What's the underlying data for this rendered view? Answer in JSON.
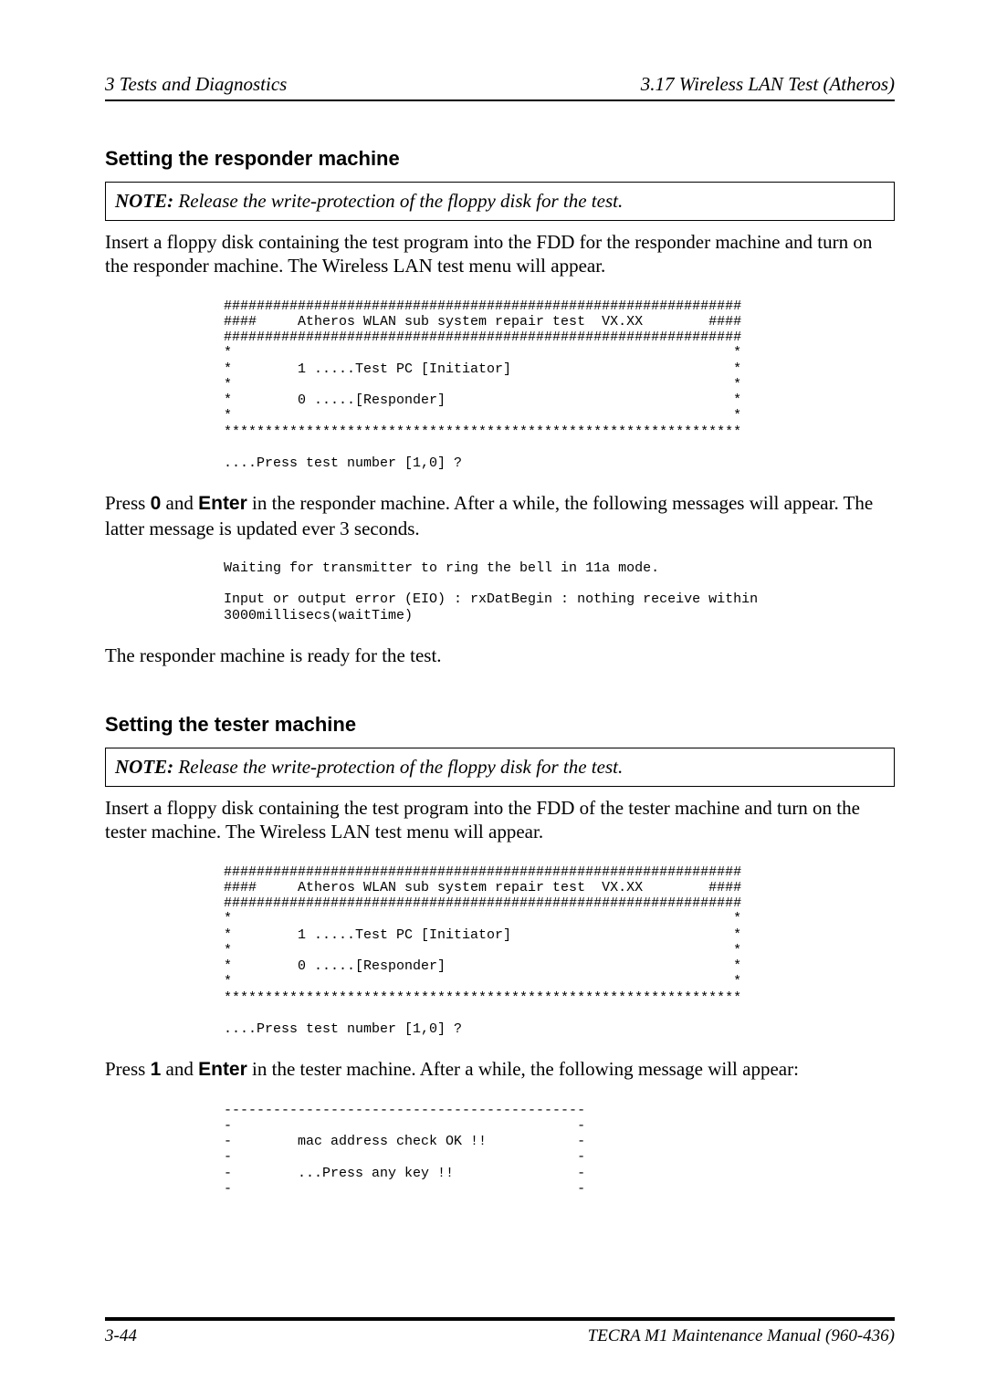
{
  "header": {
    "left": "3   Tests and Diagnostics",
    "right": "3.17  Wireless LAN Test  (Atheros)"
  },
  "section1": {
    "heading": "Setting the responder machine",
    "note_label": "NOTE:",
    "note_text": "  Release the write-protection of the floppy disk for the test.",
    "intro": "Insert a floppy disk containing the test program into the FDD for the responder machine and turn on the responder machine. The Wireless LAN test menu will appear.",
    "menu": "###############################################################\n####     Atheros WLAN sub system repair test  VX.XX        ####\n###############################################################\n*                                                             *\n*        1 .....Test PC [Initiator]                           *\n*                                                             *\n*        0 .....[Responder]                                   *\n*                                                             *\n***************************************************************\n\n....Press test number [1,0] ?",
    "press_prefix": "Press ",
    "press_key1": "0",
    "press_mid": " and ",
    "press_key2": "Enter",
    "press_suffix": " in the responder machine. After a while, the following messages will appear. The latter message is updated ever 3 seconds.",
    "wait_msg": "Waiting for transmitter to ring the bell in 11a mode.\n\nInput or output error (EIO) : rxDatBegin : nothing receive within\n3000millisecs(waitTime)",
    "ready": "The responder machine is ready for the test."
  },
  "section2": {
    "heading": "Setting the tester machine",
    "note_label": "NOTE:",
    "note_text": "  Release the write-protection of the floppy disk for the test.",
    "intro": "Insert a floppy disk containing the test program into the FDD of the tester machine and turn on the tester machine. The Wireless LAN test menu will appear.",
    "menu": "###############################################################\n####     Atheros WLAN sub system repair test  VX.XX        ####\n###############################################################\n*                                                             *\n*        1 .....Test PC [Initiator]                           *\n*                                                             *\n*        0 .....[Responder]                                   *\n*                                                             *\n***************************************************************\n\n....Press test number [1,0] ?",
    "press_prefix": "Press ",
    "press_key1": "1",
    "press_mid": " and ",
    "press_key2": "Enter",
    "press_suffix": " in the tester machine. After a while, the following message will appear:",
    "mac_block": "--------------------------------------------\n-                                          -\n-        mac address check OK !!           -\n-                                          -\n-        ...Press any key !!               -\n-                                          -"
  },
  "footer": {
    "left": "3-44",
    "right": "TECRA M1 Maintenance Manual (960-436)"
  }
}
